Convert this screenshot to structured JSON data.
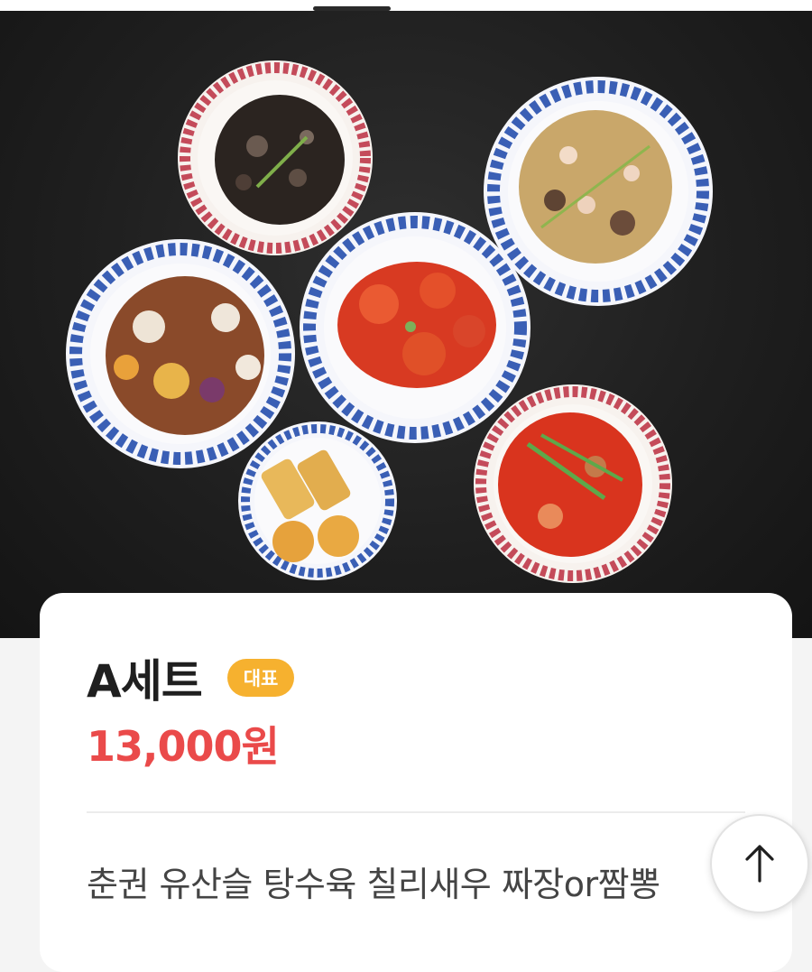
{
  "hero": {
    "image_description_icon": "food-photo"
  },
  "product": {
    "name": "A세트",
    "badge": "대표",
    "price": "13,000원",
    "description": "춘권 유산슬 탕수육 칠리새우 짜장or짬뽕"
  },
  "scroll_top": {
    "icon": "arrow-up-icon"
  },
  "colors": {
    "price": "#ea4a4a",
    "badge": "#f6b12f",
    "hero_background": "#1f1f1f"
  }
}
